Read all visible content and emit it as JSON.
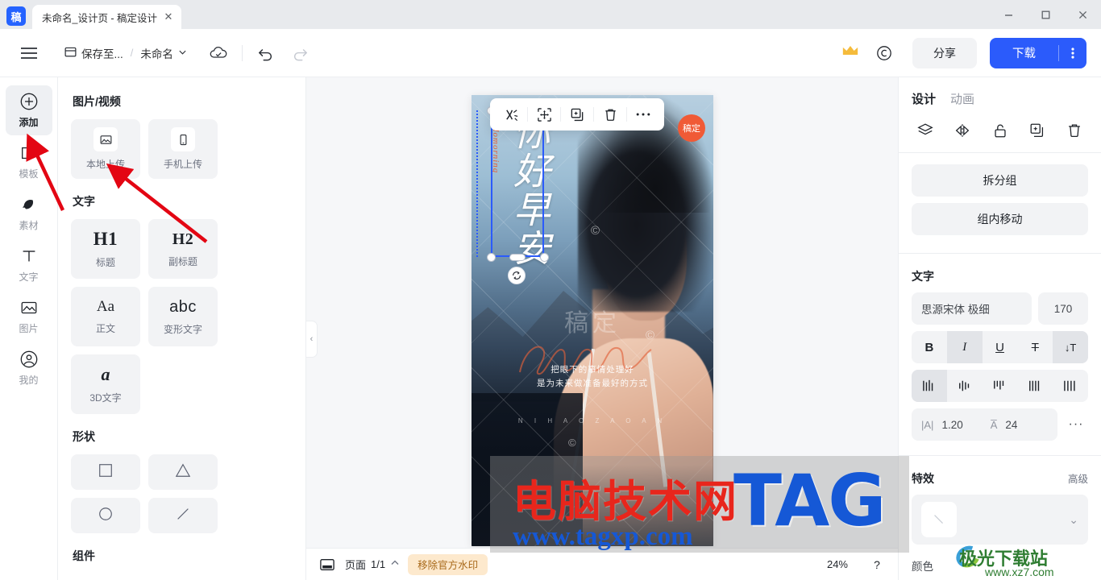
{
  "window": {
    "app_logo_text": "稿",
    "tab_title": "未命名_设计页 - 稿定设计",
    "tab_close": "✕",
    "minimize": "—",
    "maximize": "▢",
    "close": "✕"
  },
  "header": {
    "menu_icon": "hamburger-icon",
    "save_to_label": "保存至...",
    "separator": "/",
    "doc_name": "未命名",
    "cloud_status_icon": "cloud-check-icon",
    "undo_icon": "undo-icon",
    "redo_icon": "redo-icon",
    "vip_icon": "crown-icon",
    "copyright_icon": "copyright-icon",
    "share_label": "分享",
    "download_label": "下载",
    "download_more": "⋮"
  },
  "rail": {
    "items": [
      {
        "label": "添加",
        "icon": "plus-circle-icon",
        "active": true
      },
      {
        "label": "模板",
        "icon": "template-icon",
        "active": false
      },
      {
        "label": "素材",
        "icon": "material-icon",
        "active": false
      },
      {
        "label": "文字",
        "icon": "text-t-icon",
        "active": false
      },
      {
        "label": "图片",
        "icon": "picture-icon",
        "active": false
      },
      {
        "label": "我的",
        "icon": "user-circle-icon",
        "active": false
      }
    ]
  },
  "panel": {
    "sections": [
      {
        "title": "图片/视频",
        "cards": [
          {
            "label": "本地上传",
            "glyph": "image-icon"
          },
          {
            "label": "手机上传",
            "glyph": "phone-icon"
          }
        ]
      },
      {
        "title": "文字",
        "cards": [
          {
            "label": "标题",
            "glyph": "H1"
          },
          {
            "label": "副标题",
            "glyph": "H2"
          },
          {
            "label": "正文",
            "glyph": "Aa"
          },
          {
            "label": "变形文字",
            "glyph": "abc"
          },
          {
            "label": "3D文字",
            "glyph": "a"
          }
        ]
      },
      {
        "title": "形状",
        "shapes": [
          "square-shape",
          "triangle-shape",
          "circle-shape",
          "line-shape"
        ]
      },
      {
        "title": "组件"
      }
    ],
    "collapse_icon": "‹"
  },
  "canvas": {
    "object_toolbar": [
      {
        "icon": "ungroup-icon",
        "name": "ungroup"
      },
      {
        "icon": "crop-move-icon",
        "name": "crop"
      },
      {
        "icon": "duplicate-icon",
        "name": "duplicate"
      },
      {
        "icon": "trash-icon",
        "name": "delete"
      },
      {
        "icon": "more-icon",
        "name": "more"
      }
    ],
    "badge_text": "稿定",
    "headline": "你好早安",
    "headline_en": "hellomorning",
    "watermark_logo": "稿定",
    "watermark_c": "©",
    "quote_line1": "把眼下的事情处理好",
    "quote_line2": "是为未来做准备最好的方式",
    "pinyin": "N I H A O   Z A O A N",
    "rotate_icon": "rotate-icon"
  },
  "right_panel": {
    "tabs": [
      {
        "label": "设计",
        "active": true
      },
      {
        "label": "动画",
        "active": false
      }
    ],
    "tool_icons": [
      "layers-icon",
      "flip-icon",
      "unlock-icon",
      "duplicate-icon",
      "trash-icon"
    ],
    "buttons": [
      {
        "label": "拆分组"
      },
      {
        "label": "组内移动"
      }
    ],
    "text_section_title": "文字",
    "font_name": "思源宋体 极细",
    "font_size": "170",
    "style_buttons": [
      {
        "glyph": "B",
        "name": "bold",
        "on": false
      },
      {
        "glyph": "I",
        "name": "italic",
        "on": true
      },
      {
        "glyph": "U",
        "name": "underline",
        "on": false
      },
      {
        "glyph": "T",
        "name": "strikethrough",
        "on": false
      },
      {
        "glyph": "↓T",
        "name": "vertical-text",
        "on": true
      }
    ],
    "align_buttons": [
      {
        "name": "align-left",
        "on": true
      },
      {
        "name": "align-center",
        "on": false
      },
      {
        "name": "align-right",
        "on": false
      },
      {
        "name": "align-justify",
        "on": false
      },
      {
        "name": "align-distribute",
        "on": false
      }
    ],
    "line_height_icon": "|A|",
    "line_height": "1.20",
    "letter_spacing_icon": "A̅",
    "letter_spacing": "24",
    "more_dots": "···",
    "effect_section_title": "特效",
    "effect_advanced": "高级",
    "effect_value": "",
    "effect_chevron": "⌄",
    "color_label": "颜色"
  },
  "bottom_bar": {
    "page_panel_icon": "page-panel-icon",
    "page_label": "页面",
    "page_value": "1/1",
    "page_chevron": "⌃",
    "remove_watermark": "移除官方水印",
    "zoom": "24%",
    "help": "?"
  },
  "site_watermarks": {
    "red_text": "电脑技术网",
    "url_text": "www.tagxp.com",
    "tag_text": "TAG",
    "jg_text": "极光下载站",
    "jg_url": "www.xz7.com"
  },
  "colors": {
    "accent_blue": "#2b5bfb",
    "panel_gray": "#f2f3f5",
    "badge_orange": "#f05a36",
    "watermark_btn": "#fde9cd",
    "annotation_red": "#e30613"
  }
}
